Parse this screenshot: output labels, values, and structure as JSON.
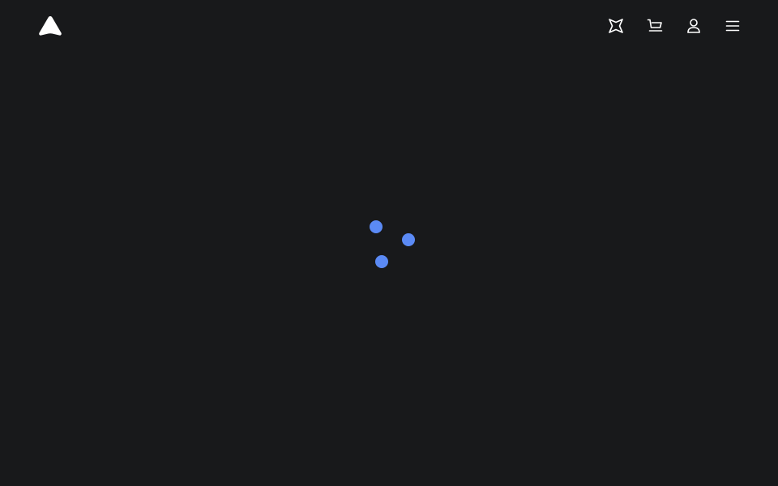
{
  "colors": {
    "background": "#18191b",
    "icon": "#ffffff",
    "spinner_accent": "#5b8af5"
  },
  "header": {
    "logo_icon": "triangle-logo-icon",
    "nav": [
      {
        "id": "explore",
        "icon": "sparkle-icon"
      },
      {
        "id": "cart",
        "icon": "cart-icon"
      },
      {
        "id": "account",
        "icon": "user-icon"
      },
      {
        "id": "menu",
        "icon": "hamburger-menu-icon"
      }
    ]
  },
  "loading": {
    "state": "loading",
    "indicator": "spinner-dots",
    "dot_count": 3
  }
}
